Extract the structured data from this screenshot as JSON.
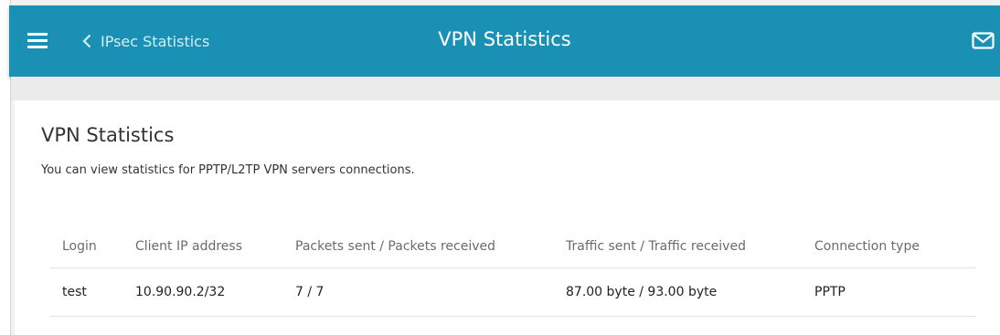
{
  "header": {
    "back_label": "IPsec Statistics",
    "title": "VPN Statistics",
    "menu_icon": "hamburger-menu-icon",
    "mail_icon": "envelope-icon",
    "bg_color": "#1a91b4"
  },
  "main": {
    "title": "VPN Statistics",
    "description": "You can view statistics for PPTP/L2TP VPN servers connections."
  },
  "table": {
    "columns": [
      "Login",
      "Client IP address",
      "Packets sent / Packets received",
      "Traffic sent / Traffic received",
      "Connection type"
    ],
    "rows": [
      [
        "test",
        "10.90.90.2/32",
        "7 / 7",
        "87.00 byte / 93.00 byte",
        "PPTP"
      ]
    ]
  }
}
